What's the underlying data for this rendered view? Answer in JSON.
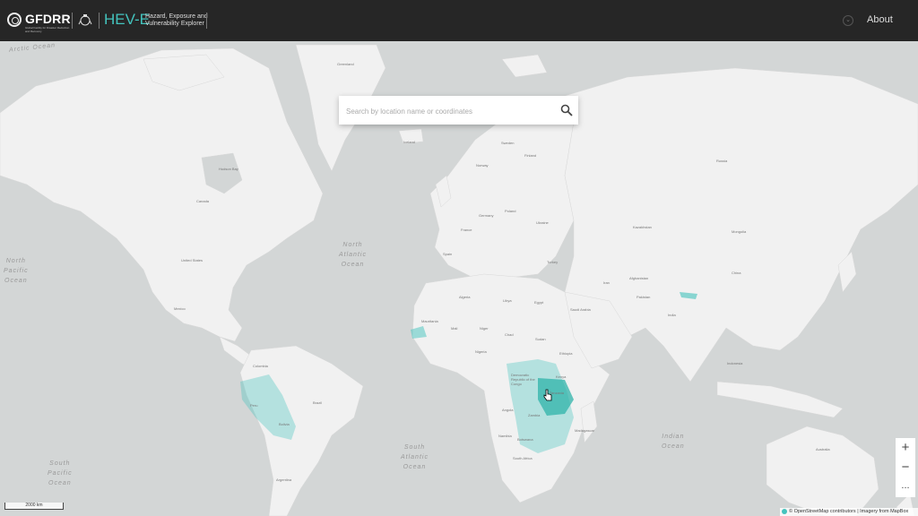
{
  "header": {
    "gfdrr_text": "GFDRR",
    "gfdrr_tagline": "Global Facility for Disaster Reduction and Recovery",
    "app_name": "HEV-E",
    "app_subtitle_line1": "Hazard, Exposure and",
    "app_subtitle_line2": "Vulnerability Explorer",
    "about_label": "About"
  },
  "search": {
    "placeholder": "Search by location name or coordinates"
  },
  "controls": {
    "zoom_in": "+",
    "zoom_out": "−",
    "more": "..."
  },
  "attribution": {
    "osm": "© OpenStreetMap contributors | Imagery from MapBox"
  },
  "scale": {
    "label": "2000 km"
  },
  "oceans": {
    "arctic": "Arctic Ocean",
    "north_atlantic": "North\nAtlantic\nOcean",
    "north_pacific": "North\nPacific\nOcean",
    "south_atlantic": "South\nAtlantic\nOcean",
    "south_pacific": "South\nPacific\nOcean",
    "indian": "Indian\nOcean"
  },
  "places": {
    "greenland": "Greenland",
    "iceland": "Iceland",
    "hudson_bay": "Hudson Bay",
    "canada": "Canada",
    "united_states": "United States",
    "mexico": "Mexico",
    "colombia": "Colombia",
    "peru": "Peru",
    "brazil": "Brazil",
    "bolivia": "Bolivia",
    "argentina": "Argentina",
    "russia": "Russia",
    "kazakhstan": "Kazakhstan",
    "mongolia": "Mongolia",
    "china": "China",
    "india": "India",
    "algeria": "Algeria",
    "libya": "Libya",
    "egypt": "Egypt",
    "niger": "Niger",
    "chad": "Chad",
    "sudan": "Sudan",
    "ethiopia": "Ethiopia",
    "drc": "Democratic Republic of the Congo",
    "kenya": "Kenya",
    "tanzania": "Tanzania",
    "angola": "Angola",
    "zambia": "Zambia",
    "namibia": "Namibia",
    "botswana": "Botswana",
    "south_africa": "South Africa",
    "madagascar": "Madagascar",
    "australia": "Australia",
    "saudi_arabia": "Saudi Arabia",
    "iran": "Iran",
    "turkey": "Turkey",
    "ukraine": "Ukraine",
    "poland": "Poland",
    "germany": "Germany",
    "france": "France",
    "spain": "Spain",
    "sweden": "Sweden",
    "finland": "Finland",
    "norway": "Norway",
    "indonesia": "Indonesia",
    "pakistan": "Pakistan",
    "afghanistan": "Afghanistan",
    "nigeria": "Nigeria",
    "mauritania": "Mauritania",
    "mali": "Mali"
  },
  "highlight_color": "#43c3bd",
  "highlight_color_dark": "#2fb3a9"
}
